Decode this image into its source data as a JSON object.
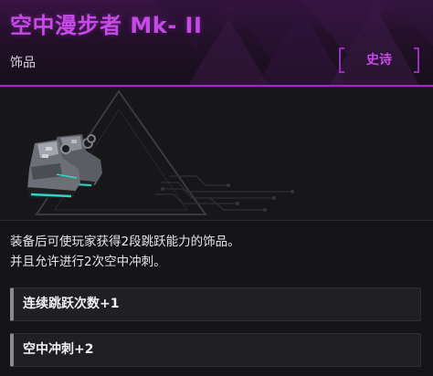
{
  "item": {
    "name": "空中漫步者 Mk- II",
    "category": "饰品",
    "rarity": "史诗",
    "icon": "mech-boots-icon"
  },
  "description": {
    "lines": [
      "装备后可使玩家获得2段跳跃能力的饰品。",
      "并且允许进行2次空中冲刺。"
    ]
  },
  "effects": [
    {
      "label": "连续跳跃次数+1"
    },
    {
      "label": "空中冲刺+2"
    }
  ],
  "colors": {
    "rarity_accent": "#b01fd4",
    "title": "#c64ae6",
    "background": "#151517",
    "effect_bar": "#8a8a90"
  }
}
